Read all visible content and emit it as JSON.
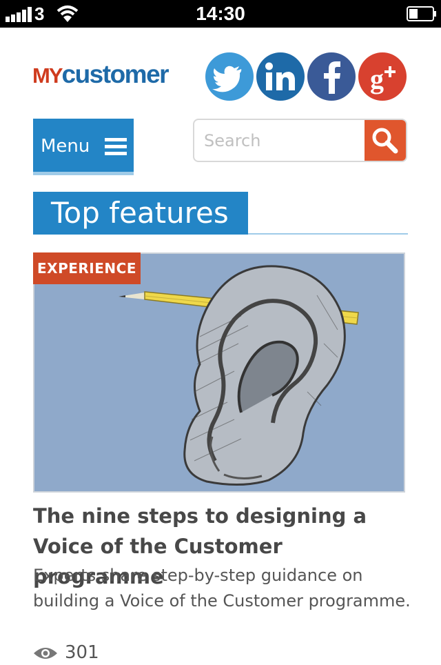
{
  "status_bar": {
    "carrier": "3",
    "time": "14:30"
  },
  "header": {
    "logo_my": "MY",
    "logo_customer": "customer",
    "social": [
      "twitter-icon",
      "linkedin-icon",
      "facebook-icon",
      "google-plus-icon"
    ],
    "social_colors": {
      "twitter": "#3d9ad8",
      "linkedin": "#1e6aa8",
      "facebook": "#3a5a97",
      "google_plus": "#d8412f"
    }
  },
  "nav": {
    "menu_label": "Menu"
  },
  "search": {
    "placeholder": "Search"
  },
  "section": {
    "title": "Top features"
  },
  "article": {
    "tag": "EXPERIENCE",
    "title": "The nine steps to designing a Voice of the Customer programme",
    "summary": "Experts share step-by-step guidance on building a Voice of the Customer programme.",
    "views": "301"
  },
  "colors": {
    "accent_blue": "#2385c6",
    "accent_orange": "#cf4a27",
    "search_button": "#e0562d"
  }
}
